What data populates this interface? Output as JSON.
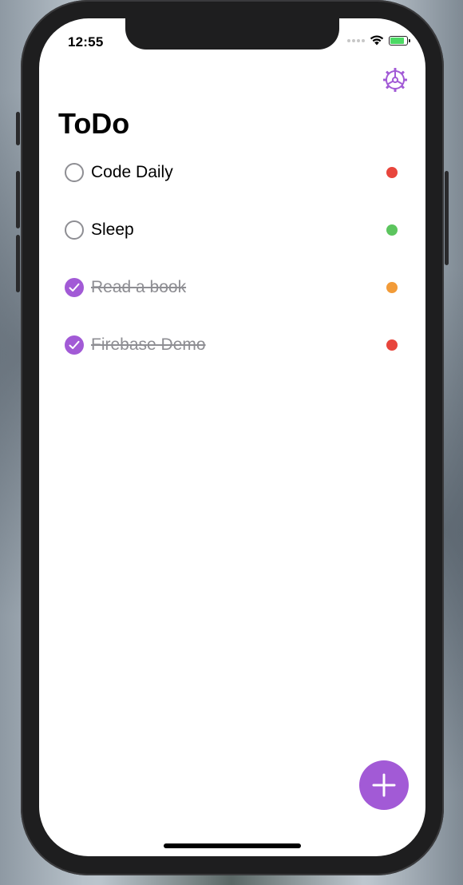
{
  "status_bar": {
    "time": "12:55",
    "battery_level": 0.85
  },
  "header": {
    "title": "ToDo",
    "settings_icon": "gear-icon"
  },
  "colors": {
    "accent": "#a25ad6",
    "priority_high": "#e8453c",
    "priority_low": "#5cc55e",
    "priority_medium": "#f29b38",
    "muted_text": "#8e8e93"
  },
  "todos": [
    {
      "label": "Code Daily",
      "completed": false,
      "priority_color": "#e8453c"
    },
    {
      "label": "Sleep",
      "completed": false,
      "priority_color": "#5cc55e"
    },
    {
      "label": "Read a book",
      "completed": true,
      "priority_color": "#f29b38"
    },
    {
      "label": "Firebase Demo",
      "completed": true,
      "priority_color": "#e8453c"
    }
  ],
  "fab": {
    "icon": "plus-icon"
  }
}
